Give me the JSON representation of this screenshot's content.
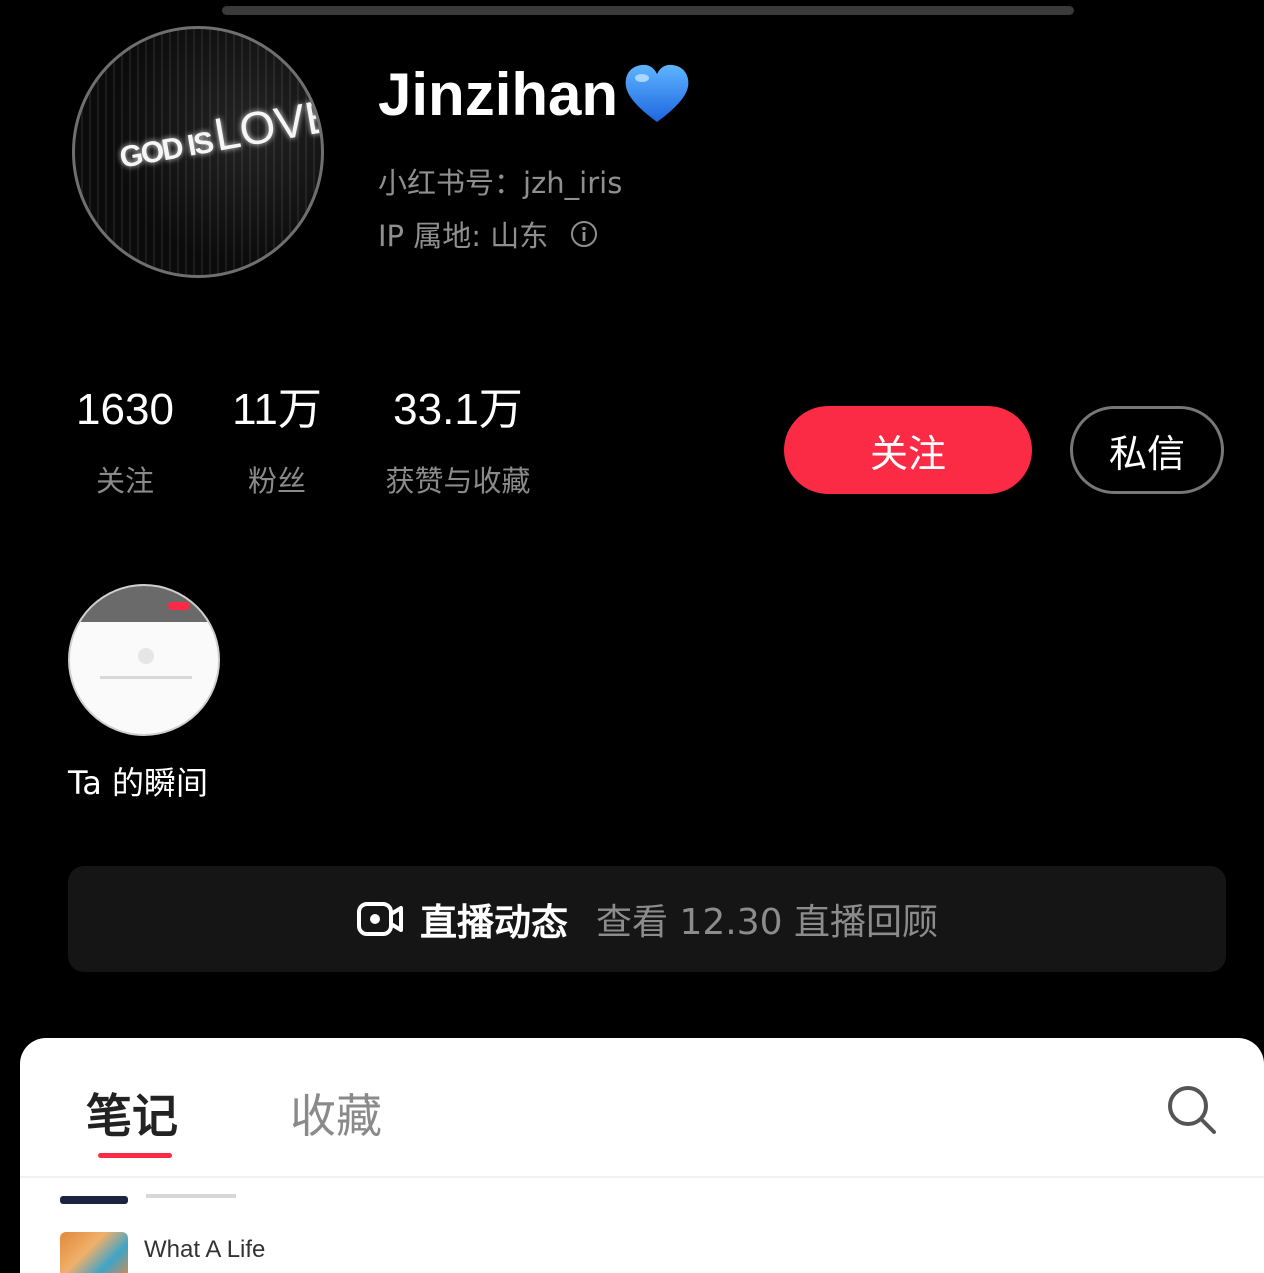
{
  "profile": {
    "avatar_text_small": "GOD IS",
    "avatar_text_big": "LOVE",
    "name": "Jinzihan",
    "name_emoji": "blue-heart-icon",
    "id_line": "小红书号：jzh_iris",
    "ip_line": "IP 属地: 山东"
  },
  "stats": [
    {
      "value": "1630",
      "label": "关注"
    },
    {
      "value": "11万",
      "label": "粉丝"
    },
    {
      "value": "33.1万",
      "label": "获赞与收藏"
    }
  ],
  "actions": {
    "follow_label": "关注",
    "message_label": "私信"
  },
  "moments": {
    "label": "Ta 的瞬间"
  },
  "live": {
    "icon": "live-video-icon",
    "title": "直播动态",
    "subtitle": "查看 12.30 直播回顾"
  },
  "tabs": [
    {
      "label": "笔记",
      "active": true
    },
    {
      "label": "收藏",
      "active": false
    }
  ],
  "notes": [
    {
      "title": "What A Life"
    }
  ],
  "colors": {
    "accent": "#fb2b46",
    "background": "#000000",
    "muted_text": "#8f8f8f"
  }
}
